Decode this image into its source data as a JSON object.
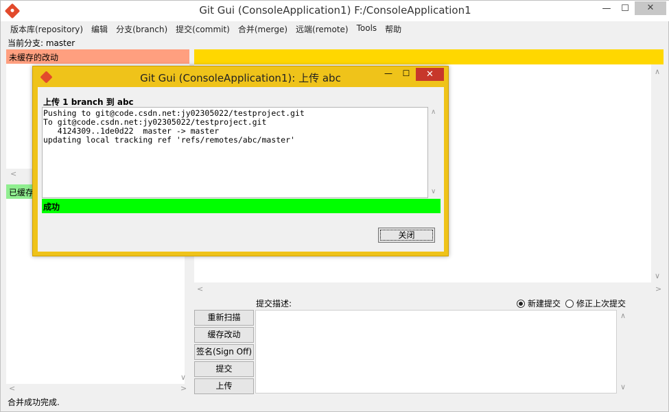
{
  "window": {
    "title": "Git Gui (ConsoleApplication1) F:/ConsoleApplication1",
    "min_glyph": "—",
    "max_glyph": "☐",
    "close_glyph": "✕"
  },
  "menu": [
    "版本库(repository)",
    "编辑",
    "分支(branch)",
    "提交(commit)",
    "合并(merge)",
    "远端(remote)",
    "Tools",
    "帮助"
  ],
  "branch_line": "当前分支: master",
  "unstaged": {
    "header": "未缓存的改动"
  },
  "staged": {
    "header": "已缓存"
  },
  "commit": {
    "desc_label": "提交描述:",
    "radio_new": "新建提交",
    "radio_amend": "修正上次提交",
    "buttons": [
      "重新扫描",
      "缓存改动",
      "签名(Sign Off)",
      "提交",
      "上传"
    ]
  },
  "status": "合并成功完成.",
  "dialog": {
    "title": "Git Gui (ConsoleApplication1): 上传 abc",
    "heading": "上传 1 branch 到 abc",
    "log": "Pushing to git@code.csdn.net:jy02305022/testproject.git\nTo git@code.csdn.net:jy02305022/testproject.git\n   4124309..1de0d22  master -> master\nupdating local tracking ref 'refs/remotes/abc/master'",
    "success": "成功",
    "close_button": "关闭",
    "min_glyph": "—",
    "max_glyph": "☐",
    "close_glyph": "✕"
  },
  "colors": {
    "unstaged_header": "#ff9f7f",
    "staged_header": "#90ee90",
    "diff_header": "#ffd700",
    "dialog_frame": "#efc31a",
    "success": "#00ff00",
    "close_red": "#c7372b"
  }
}
